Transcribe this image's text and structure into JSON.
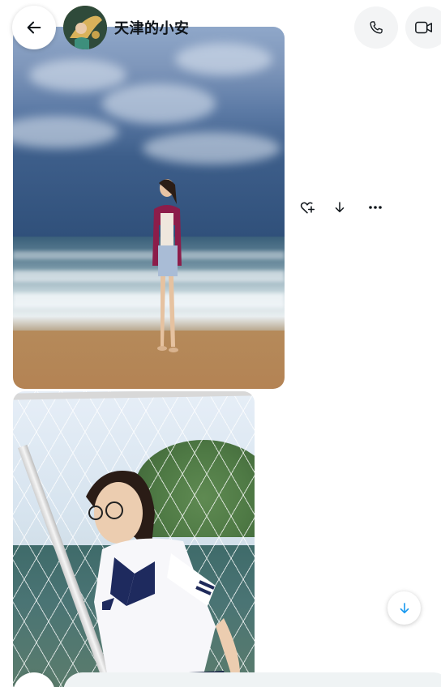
{
  "header": {
    "contact_name": "天津的小安",
    "back_icon": "arrow-left-icon",
    "call_icon": "phone-icon",
    "video_icon": "video-camera-icon"
  },
  "messages": [
    {
      "type": "image",
      "description_icon": "photo-beach"
    },
    {
      "type": "image",
      "description_icon": "photo-goal-net"
    }
  ],
  "message_actions": {
    "react_icon": "heart-plus-icon",
    "download_icon": "download-arrow-icon",
    "more_icon": "more-horizontal-icon"
  },
  "scroll_button": {
    "icon": "arrow-down-icon",
    "color": "#1d9bf0"
  },
  "composer": {
    "placeholder": "",
    "value": ""
  },
  "colors": {
    "accent": "#1d9bf0",
    "text": "#0f1419",
    "input_bg": "#eff3f4"
  }
}
